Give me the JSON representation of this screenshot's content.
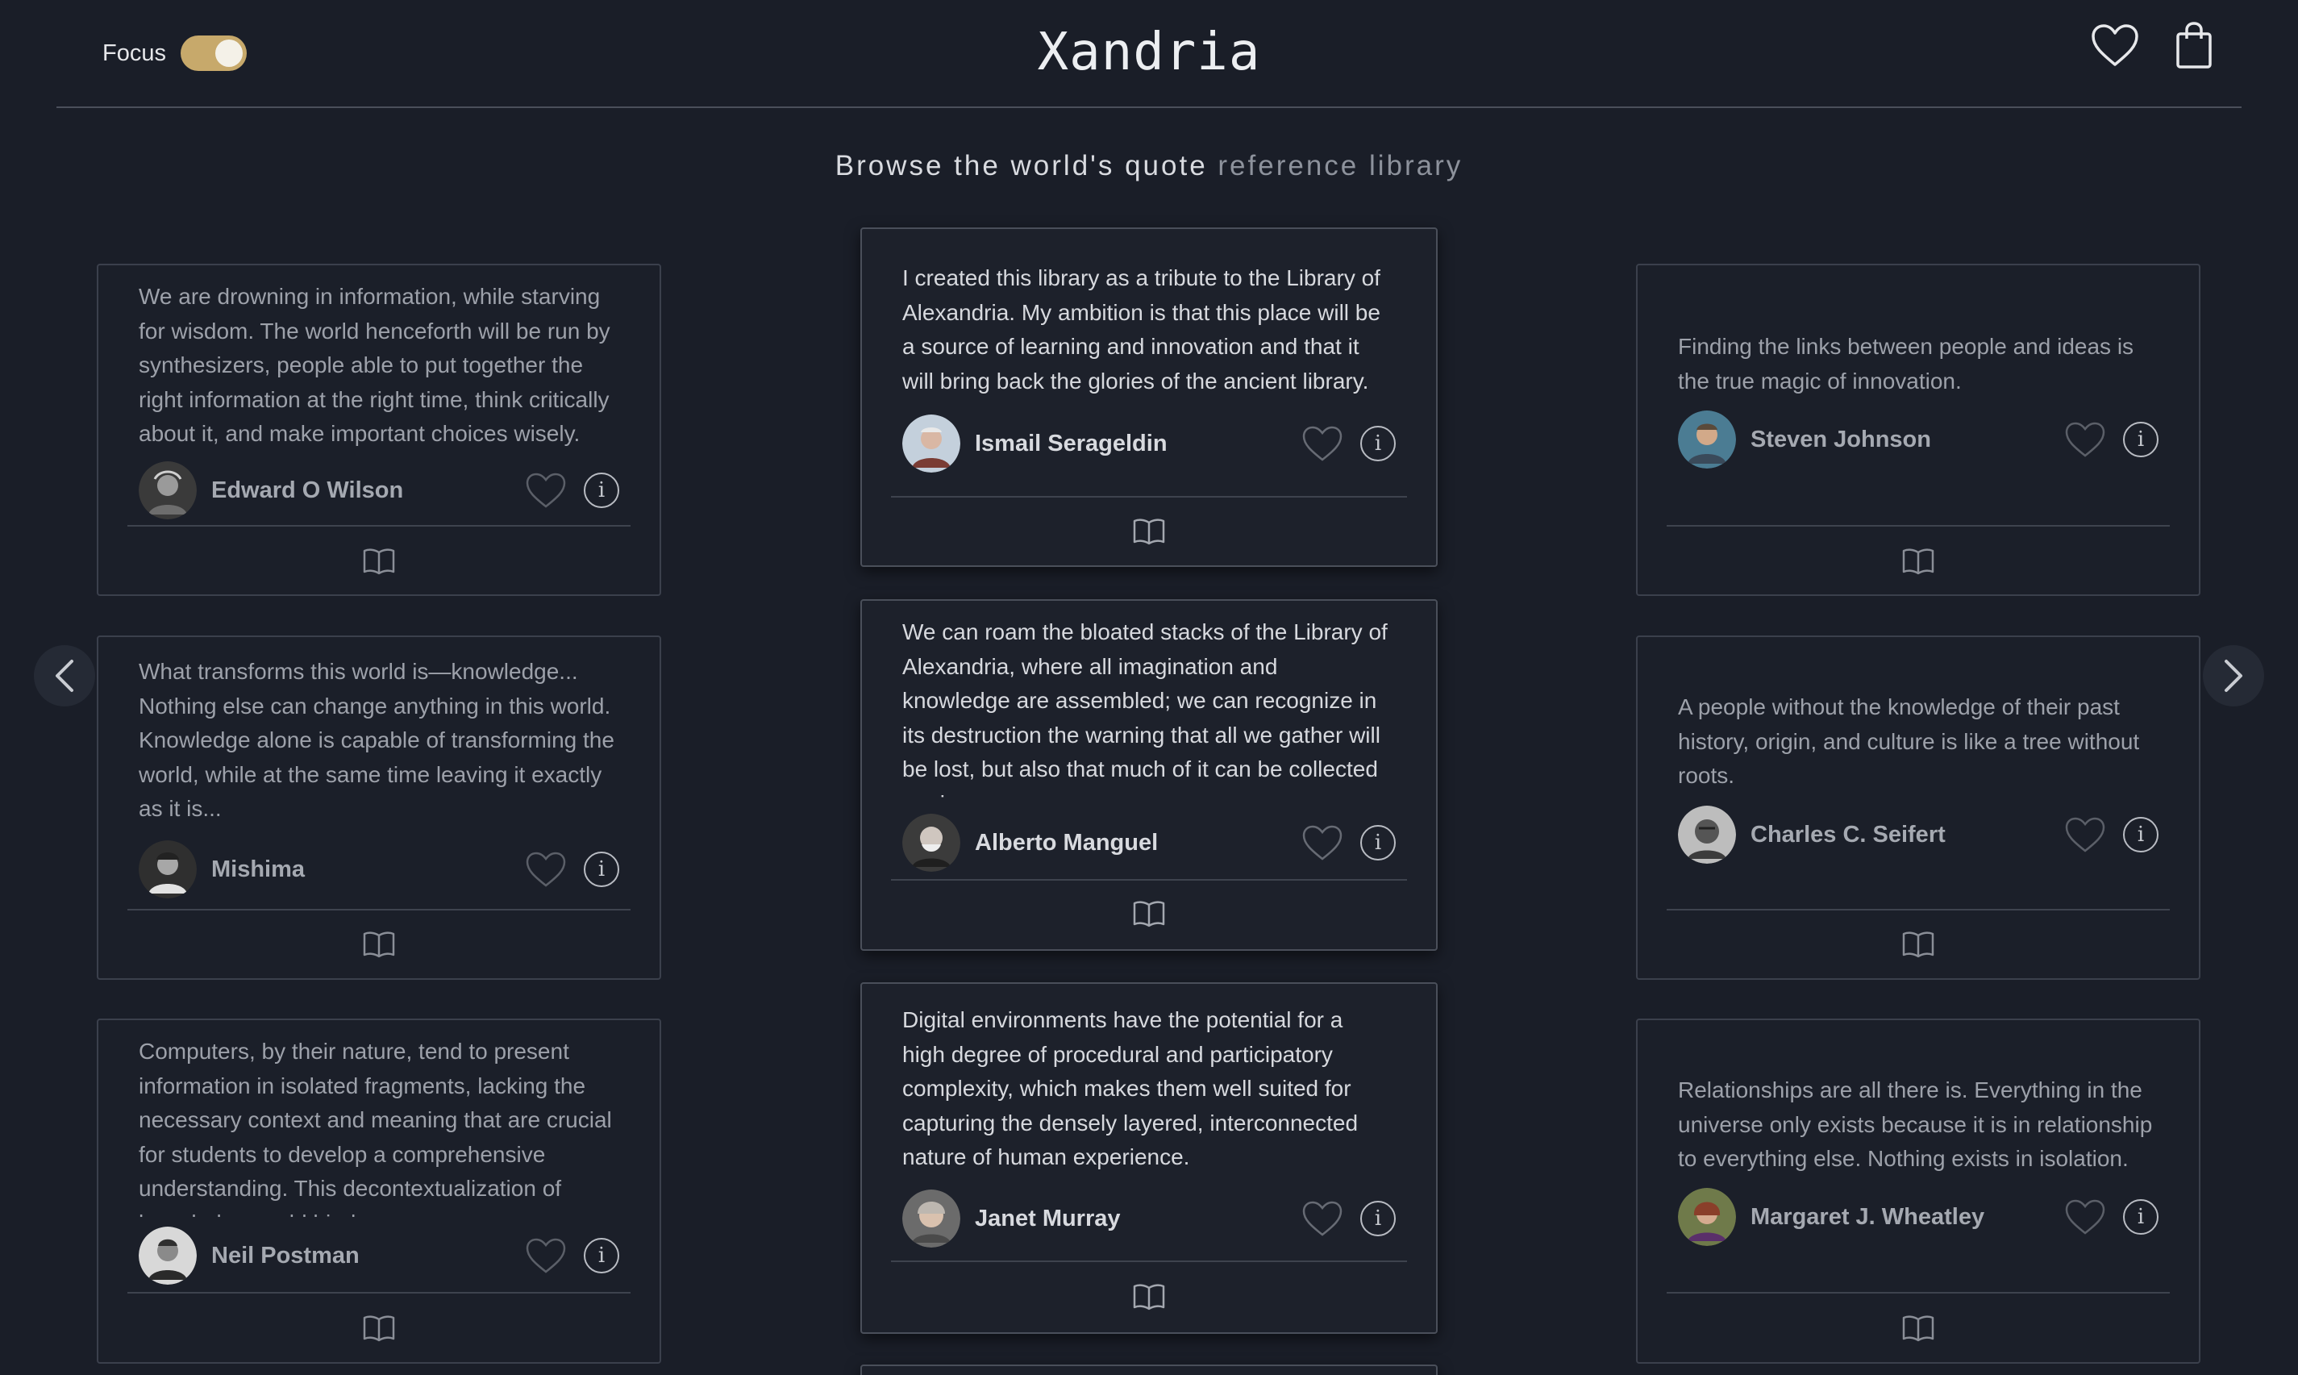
{
  "header": {
    "focus_label": "Focus",
    "focus_on": true,
    "brand": "Xandria",
    "icons": [
      "heart-icon",
      "shopping-bag-icon"
    ]
  },
  "tagline": {
    "part1": "Browse the world's quote ",
    "part2": "reference library"
  },
  "nav": {
    "prev_icon": "chevron-left-icon",
    "next_icon": "chevron-right-icon"
  },
  "columns": {
    "left": [
      {
        "quote": "We are drowning in information, while starving for wisdom. The world henceforth will be run by synthesizers, people able to put together the right information at the right time, think critically about it, and make important choices wisely.",
        "author": "Edward O Wilson"
      },
      {
        "quote": "What transforms this world is—knowledge... Nothing else can change anything in this world. Knowledge alone is capable of transforming the world, while at the same time leaving it exactly as it is...",
        "author": "Mishima"
      },
      {
        "quote": "Computers, by their nature, tend to present information in isolated fragments, lacking the necessary context and meaning that are crucial for students to develop a comprehensive understanding. This decontextualization of knowledge could hinder",
        "author": "Neil Postman"
      }
    ],
    "middle": [
      {
        "quote": "I created this library as a tribute to the Library of Alexandria. My ambition is that this place will be a source of learning and innovation and that it will bring back the glories of the ancient library.",
        "author": "Ismail Serageldin"
      },
      {
        "quote": "We can roam the bloated stacks of the Library of Alexandria, where all imagination and knowledge are assembled; we can recognize in its destruction the warning that all we gather will be lost, but also that much of it can be collected again",
        "author": "Alberto Manguel"
      },
      {
        "quote": "Digital environments have the potential for a high degree of procedural and participatory complexity, which makes them well suited for capturing the densely layered, interconnected nature of human experience.",
        "author": "Janet Murray"
      }
    ],
    "right": [
      {
        "quote": "Finding the links between people and ideas is the true magic of innovation.",
        "author": "Steven Johnson"
      },
      {
        "quote": "A people without the knowledge of their past history, origin, and culture is like a tree without roots.",
        "author": "Charles C. Seifert"
      },
      {
        "quote": "Relationships are all there is. Everything in the universe only exists because it is in relationship to everything else. Nothing exists in isolation.",
        "author": "Margaret J. Wheatley"
      }
    ]
  },
  "card_icons": {
    "like": "heart-icon",
    "info": "info-icon",
    "info_glyph": "i",
    "read": "book-icon"
  },
  "colors": {
    "background": "#1a1e28",
    "accent": "#c7a96b",
    "card_border": "#3b404c"
  }
}
